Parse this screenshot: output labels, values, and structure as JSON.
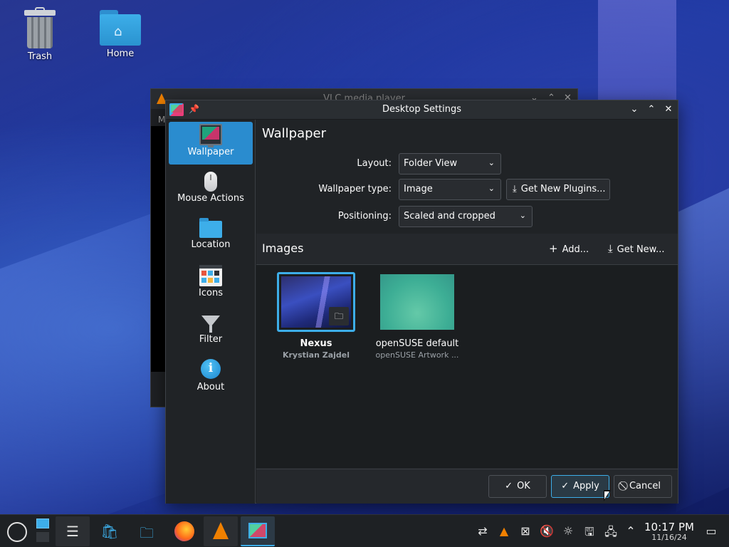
{
  "desktop": {
    "icons": [
      {
        "label": "Trash"
      },
      {
        "label": "Home"
      }
    ]
  },
  "vlc_window": {
    "title": "VLC media player",
    "menu_fragment": "M"
  },
  "dialog": {
    "title": "Desktop Settings",
    "sidebar": [
      {
        "label": "Wallpaper",
        "icon": "monitor-icon",
        "active": true
      },
      {
        "label": "Mouse Actions",
        "icon": "mouse-icon"
      },
      {
        "label": "Location",
        "icon": "folder-icon"
      },
      {
        "label": "Icons",
        "icon": "icons-icon"
      },
      {
        "label": "Filter",
        "icon": "filter-icon"
      },
      {
        "label": "About",
        "icon": "info-icon"
      }
    ],
    "page_title": "Wallpaper",
    "form": {
      "layout_label": "Layout:",
      "layout_value": "Folder View",
      "type_label": "Wallpaper type:",
      "type_value": "Image",
      "get_plugins_label": "Get New Plugins...",
      "positioning_label": "Positioning:",
      "positioning_value": "Scaled and cropped"
    },
    "images": {
      "heading": "Images",
      "add_label": "Add...",
      "get_new_label": "Get New...",
      "items": [
        {
          "name": "Nexus",
          "author": "Krystian Zajdel",
          "selected": true
        },
        {
          "name": "openSUSE default",
          "author": "openSUSE Artwork ..."
        }
      ]
    },
    "footer": {
      "ok_label": "OK",
      "apply_label": "Apply",
      "cancel_label": "Cancel"
    }
  },
  "taskbar": {
    "clock_time": "10:17 PM",
    "clock_date": "11/16/24"
  },
  "colors": {
    "accent": "#3daee9",
    "window_bg": "#202326",
    "panel_bg": "#1e2124"
  }
}
